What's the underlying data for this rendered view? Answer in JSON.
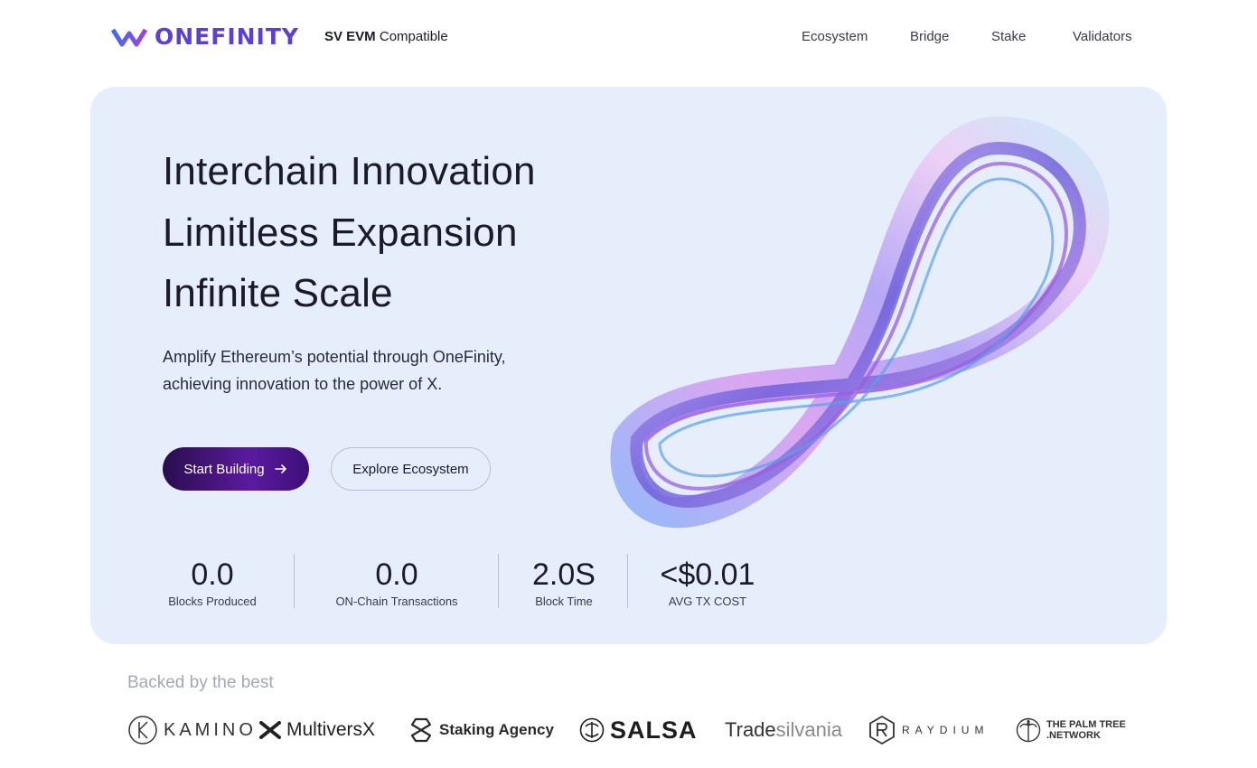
{
  "header": {
    "brand": "ONEFINITY",
    "tag_strong": "SV EVM",
    "tag_rest": "Compatible",
    "nav": [
      "Ecosystem",
      "Bridge",
      "Stake",
      "Validators"
    ]
  },
  "hero": {
    "headline_1": "Interchain Innovation",
    "headline_2": "Limitless Expansion",
    "headline_3": "Infinite Scale",
    "sub_1": "Amplify Ethereum’s potential through OneFinity,",
    "sub_2": "achieving innovation to the power of X.",
    "primary_button": "Start Building",
    "secondary_button": "Explore Ecosystem"
  },
  "stats": [
    {
      "value": "0.0",
      "label": "Blocks Produced"
    },
    {
      "value": "0.0",
      "label": "ON-Chain Transactions"
    },
    {
      "value": "2.0S",
      "label": "Block Time"
    },
    {
      "value": "<$0.01",
      "label": "AVG TX COST"
    }
  ],
  "backers": {
    "title": "Backed by the best",
    "partners": {
      "kamino": "KAMINO",
      "multiversx": "MultiversX",
      "staking_agency": "Staking Agency",
      "salsa": "SALSA",
      "trade": "Trade",
      "silvania": "silvania",
      "raydium": "RAYDIUM",
      "palm_1": "THE PALM TREE",
      "palm_2": ".NETWORK"
    }
  },
  "colors": {
    "brand": "#5b3fd6",
    "hero_bg": "#e6eefc",
    "primary_button": "#4a1690"
  }
}
